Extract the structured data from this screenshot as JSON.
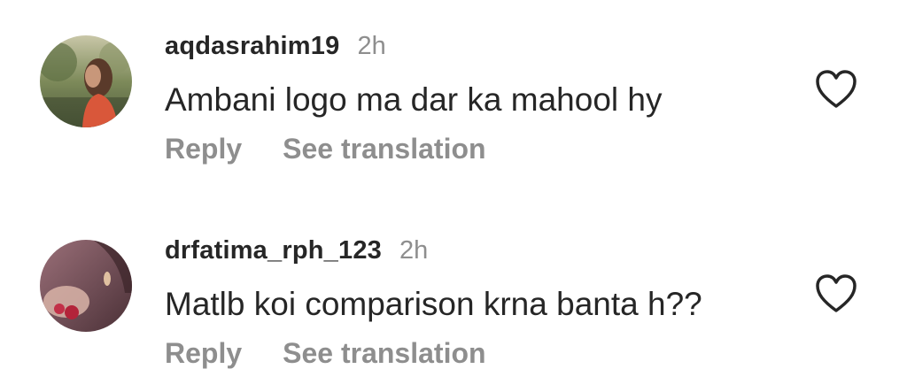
{
  "comments": [
    {
      "username": "aqdasrahim19",
      "time": "2h",
      "text": "Ambani logo ma dar ka mahool hy",
      "reply_label": "Reply",
      "translate_label": "See translation",
      "avatar_icon": "user-avatar-photo",
      "like_icon": "heart-outline-icon"
    },
    {
      "username": "drfatima_rph_123",
      "time": "2h",
      "text": "Matlb koi comparison krna banta h??",
      "reply_label": "Reply",
      "translate_label": "See translation",
      "avatar_icon": "user-avatar-photo",
      "like_icon": "heart-outline-icon"
    }
  ],
  "colors": {
    "primary_text": "#262626",
    "secondary_text": "#8e8e8e",
    "background": "#ffffff"
  }
}
